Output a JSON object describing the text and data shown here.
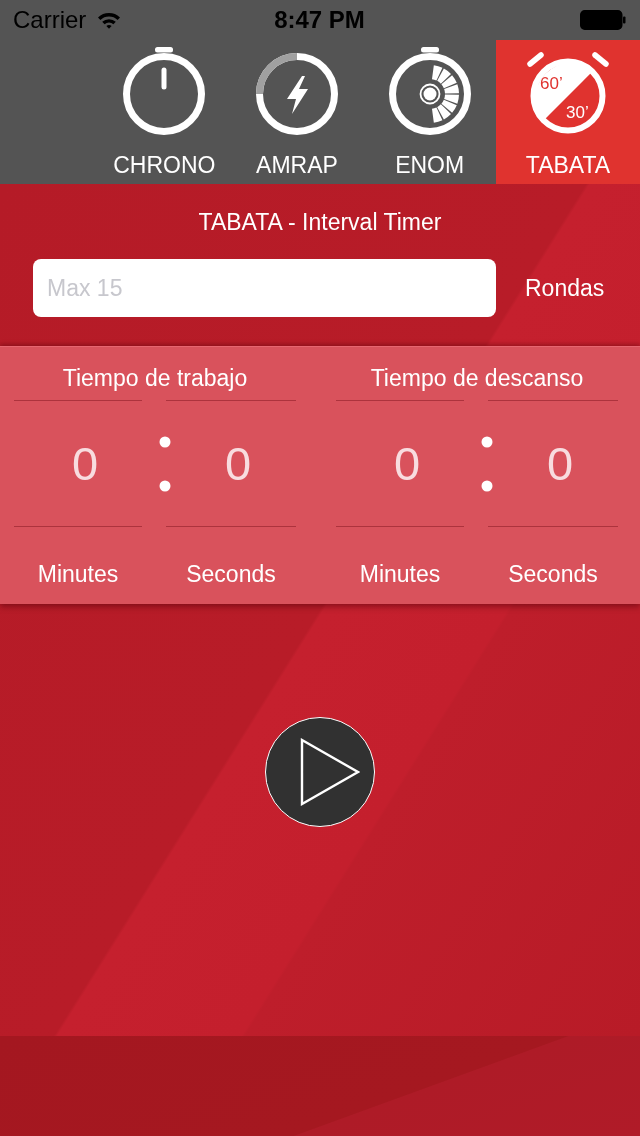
{
  "status_bar": {
    "carrier": "Carrier",
    "time": "8:47 PM"
  },
  "tabs": [
    {
      "kind": "chrono",
      "label": "CHRONO",
      "selected": false
    },
    {
      "kind": "amrap",
      "label": "AMRAP",
      "selected": false
    },
    {
      "kind": "enom",
      "label": "ENOM",
      "selected": false
    },
    {
      "kind": "tabata",
      "label": "TABATA",
      "selected": true,
      "icon_labels": [
        "60’",
        "30’"
      ]
    }
  ],
  "title": "TABATA - Interval Timer",
  "rounds": {
    "placeholder": "Max 15",
    "label": "Rondas"
  },
  "intervals": [
    {
      "title": "Tiempo de trabajo",
      "pickers": [
        {
          "value": "0",
          "label": "Minutes"
        },
        {
          "value": "0",
          "label": "Seconds"
        }
      ]
    },
    {
      "title": "Tiempo de descanso",
      "pickers": [
        {
          "value": "0",
          "label": "Minutes"
        },
        {
          "value": "0",
          "label": "Seconds"
        }
      ]
    }
  ]
}
